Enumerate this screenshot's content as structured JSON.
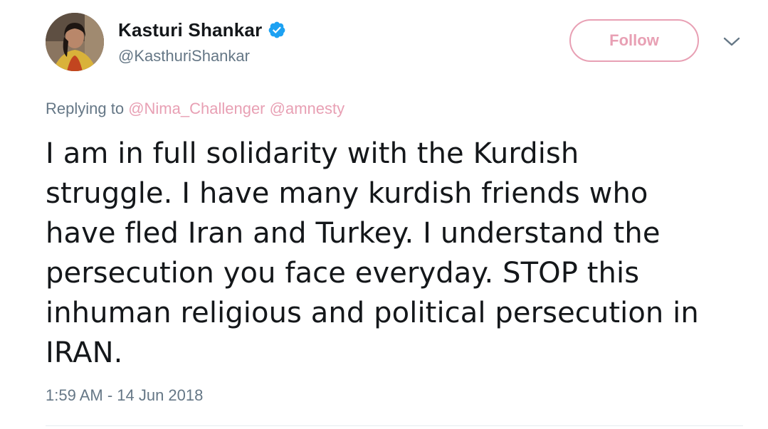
{
  "tweet": {
    "author": {
      "display_name": "Kasturi Shankar",
      "handle": "@KasthuriShankar",
      "verified": true,
      "avatar": "profile-photo"
    },
    "follow_label": "Follow",
    "menu_icon": "chevron-down-icon",
    "reply": {
      "prefix": "Replying to",
      "mentions": [
        "@Nima_Challenger",
        "@amnesty"
      ]
    },
    "text_lines": [
      "I am in full solidarity with the Kurdish",
      "struggle. I have many kurdish friends who",
      "have fled Iran and Turkey. I understand the",
      "persecution you face everyday. STOP this",
      "inhuman religious and political persecution in",
      "IRAN."
    ],
    "timestamp": "1:59 AM - 14 Jun 2018"
  },
  "colors": {
    "accent": "#e8a0b4",
    "secondary_text": "#657786",
    "primary_text": "#14171a",
    "verified_badge": "#1da1f2"
  }
}
